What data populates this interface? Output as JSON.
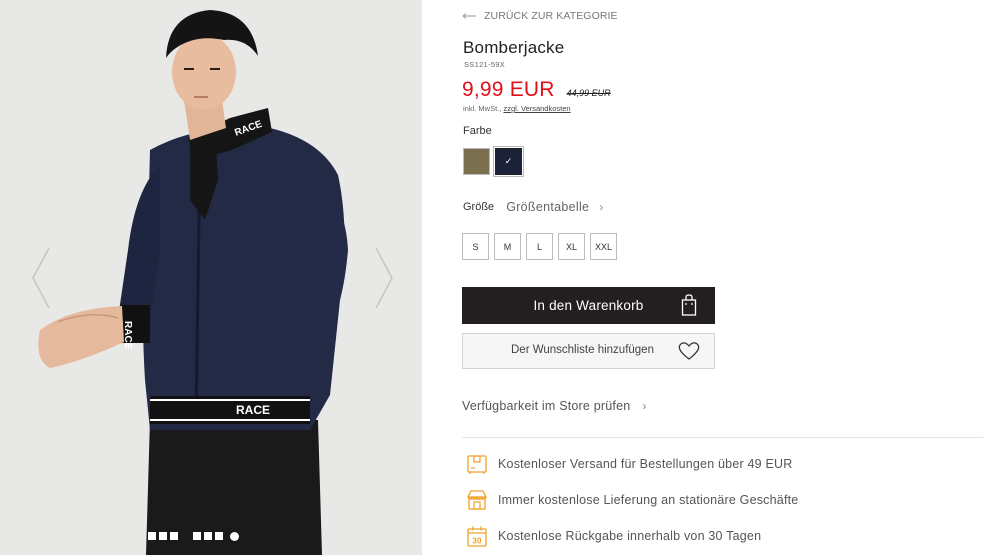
{
  "colors": {
    "accent_price": "#e0101a",
    "button_dark": "#231f20",
    "icon_orange": "#f0a12a",
    "swatch_olive": "#7a6f4e",
    "swatch_navy": "#1c2338"
  },
  "gallery": {
    "prev_icon": "chevron-left-icon",
    "next_icon": "chevron-right-icon",
    "dot_count": 7
  },
  "product": {
    "back_label": "ZURÜCK ZUR KATEGORIE",
    "title": "Bomberjacke",
    "sku": "SS121-59X",
    "price": "9,99 EUR",
    "old_price": "44,99 EUR",
    "tax_note": "inkl. MwSt.,",
    "shipping_link": "zzgl. Versandkosten",
    "color_label": "Farbe",
    "size_label": "Größe",
    "size_chart_link": "Größentabelle",
    "sizes": [
      "S",
      "M",
      "L",
      "XL",
      "XXL"
    ],
    "add_to_cart": "In den Warenkorb",
    "wishlist": "Der Wunschliste hinzufügen",
    "check_store": "Verfügbarkeit im Store prüfen",
    "selected_check": "✓"
  },
  "benefits": [
    {
      "icon": "truck-icon",
      "text": "Kostenloser Versand für Bestellungen über 49 EUR"
    },
    {
      "icon": "store-icon",
      "text": "Immer kostenlose Lieferung an stationäre Geschäfte"
    },
    {
      "icon": "calendar-30-icon",
      "text": "Kostenlose Rückgabe innerhalb von 30 Tagen"
    }
  ]
}
